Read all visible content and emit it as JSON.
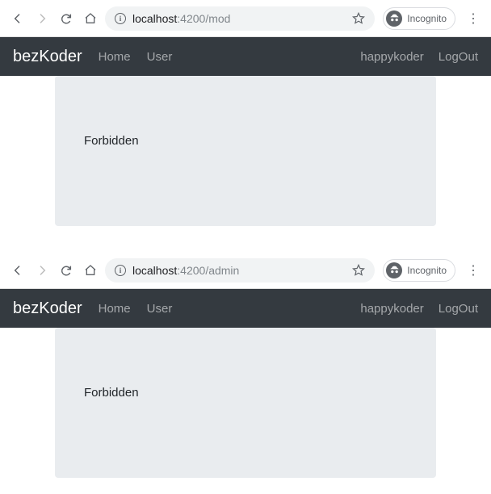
{
  "windows": [
    {
      "url_host": "localhost",
      "url_port": ":4200",
      "url_path": "/mod",
      "incognito_label": "Incognito",
      "brand": "bezKoder",
      "nav_home": "Home",
      "nav_user": "User",
      "nav_username": "happykoder",
      "nav_logout": "LogOut",
      "content_message": "Forbidden"
    },
    {
      "url_host": "localhost",
      "url_port": ":4200",
      "url_path": "/admin",
      "incognito_label": "Incognito",
      "brand": "bezKoder",
      "nav_home": "Home",
      "nav_user": "User",
      "nav_username": "happykoder",
      "nav_logout": "LogOut",
      "content_message": "Forbidden"
    }
  ]
}
